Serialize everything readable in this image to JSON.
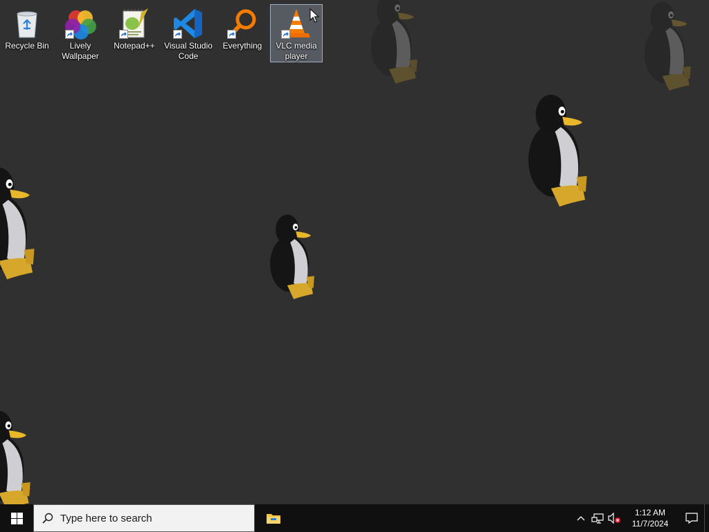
{
  "desktop": {
    "background_color": "#303030",
    "icons": [
      {
        "label": "Recycle Bin",
        "icon": "recycle-bin-icon",
        "selected": false
      },
      {
        "label": "Lively Wallpaper",
        "icon": "lively-wallpaper-icon",
        "selected": false
      },
      {
        "label": "Notepad++",
        "icon": "notepad-plus-plus-icon",
        "selected": false
      },
      {
        "label": "Visual Studio Code",
        "icon": "vscode-icon",
        "selected": false
      },
      {
        "label": "Everything",
        "icon": "everything-search-icon",
        "selected": false
      },
      {
        "label": "VLC media player",
        "icon": "vlc-cone-icon",
        "selected": true
      }
    ],
    "wallpaper": "tux-penguins"
  },
  "taskbar": {
    "background_color": "#101010",
    "start_icon": "windows-logo-icon",
    "search": {
      "placeholder": "Type here to search",
      "icon": "search-icon"
    },
    "pinned_apps": [
      {
        "name": "File Explorer",
        "icon": "folder-icon"
      }
    ],
    "tray": {
      "icons": [
        "chevron-up-icon",
        "network-icon",
        "volume-muted-icon"
      ],
      "time": "1:12 AM",
      "date": "11/7/2024",
      "notification_icon": "notification-icon"
    }
  }
}
